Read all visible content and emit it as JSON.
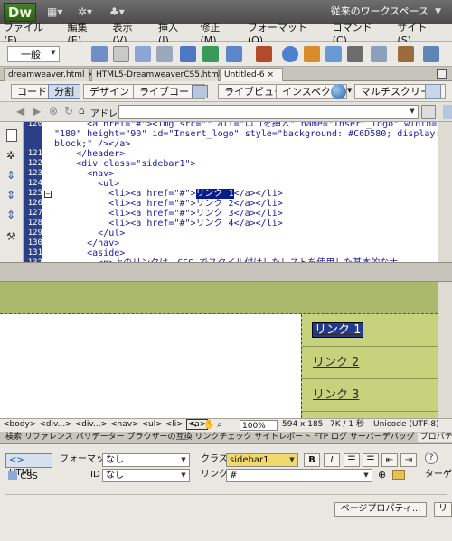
{
  "app": {
    "logo": "Dw",
    "workspace": "従来のワークスペース"
  },
  "menu": [
    "ファイル(F)",
    "編集(E)",
    "表示(V)",
    "挿入(I)",
    "修正(M)",
    "フォーマット(O)",
    "コマンド(C)",
    "サイト(S)"
  ],
  "insert_bar": {
    "category": "一般"
  },
  "doc_tabs": [
    "dreamweaver.html",
    "HTML5-DreamweaverCS5.html*",
    "Untitled-6"
  ],
  "doc_toolbar": {
    "code": "コード",
    "split": "分割",
    "design": "デザイン",
    "live_code": "ライブコード",
    "live_view": "ライブビュー",
    "inspect": "インスペクト",
    "multiscreen": "マルチスクリーン"
  },
  "address_bar": {
    "label": "アドレス:",
    "value": ""
  },
  "code": {
    "lines": [
      {
        "n": "120",
        "text": "      <a href=\"#\"><img src=\"\" alt=\"ロゴを挿入\" name=\"Insert_logo\" width=",
        "clip": true
      },
      {
        "n": "",
        "text": "\"180\" height=\"90\" id=\"Insert_logo\" style=\"background: #C6D580; display:"
      },
      {
        "n": "",
        "text": "block;\" /></a>"
      },
      {
        "n": "121",
        "text": "    </header>"
      },
      {
        "n": "122",
        "text": "    <div class=\"sidebar1\">"
      },
      {
        "n": "123",
        "text": "      <nav>"
      },
      {
        "n": "124",
        "text": "        <ul>"
      },
      {
        "n": "125",
        "pre": "          <li><a href=\"#\">",
        "hl": "リンク 1",
        "post": "</a></li>"
      },
      {
        "n": "126",
        "text": "          <li><a href=\"#\">リンク 2</a></li>"
      },
      {
        "n": "127",
        "text": "          <li><a href=\"#\">リンク 3</a></li>"
      },
      {
        "n": "128",
        "text": "          <li><a href=\"#\">リンク 4</a></li>"
      },
      {
        "n": "129",
        "text": "        </ul>"
      },
      {
        "n": "130",
        "text": "      </nav>"
      },
      {
        "n": "131",
        "text": "      <aside>"
      },
      {
        "n": "132",
        "text": "        <p>上のリンクは、CSS でスタイル付けしたリストを使用した基本的なナ"
      }
    ]
  },
  "design": {
    "links": [
      "リンク 1",
      "リンク 2",
      "リンク 3"
    ]
  },
  "status": {
    "tags": [
      "<body>",
      "<div...>",
      "<div...>",
      "<nav>",
      "<ul>",
      "<li>",
      "<a>"
    ],
    "zoom": "100%",
    "size": "594 x 185",
    "weight": "7K / 1 秒",
    "encoding": "Unicode (UTF-8)"
  },
  "panel_tabs": [
    "検索",
    "リファレンス",
    "バリデーター",
    "ブラウザーの互換",
    "リンクチェック",
    "サイトレポート",
    "FTP ログ",
    "サーバーデバッグ",
    "プロパティ"
  ],
  "properties": {
    "html_label": "HTML",
    "css_label": "CSS",
    "format_label": "フォーマット",
    "format_value": "なし",
    "id_label": "ID",
    "id_value": "なし",
    "class_label": "クラス",
    "class_value": "sidebar1",
    "link_label": "リンク",
    "link_value": "#",
    "bold": "B",
    "italic": "I",
    "target_label": "ターゲ",
    "page_props": "ページプロパティ..."
  }
}
